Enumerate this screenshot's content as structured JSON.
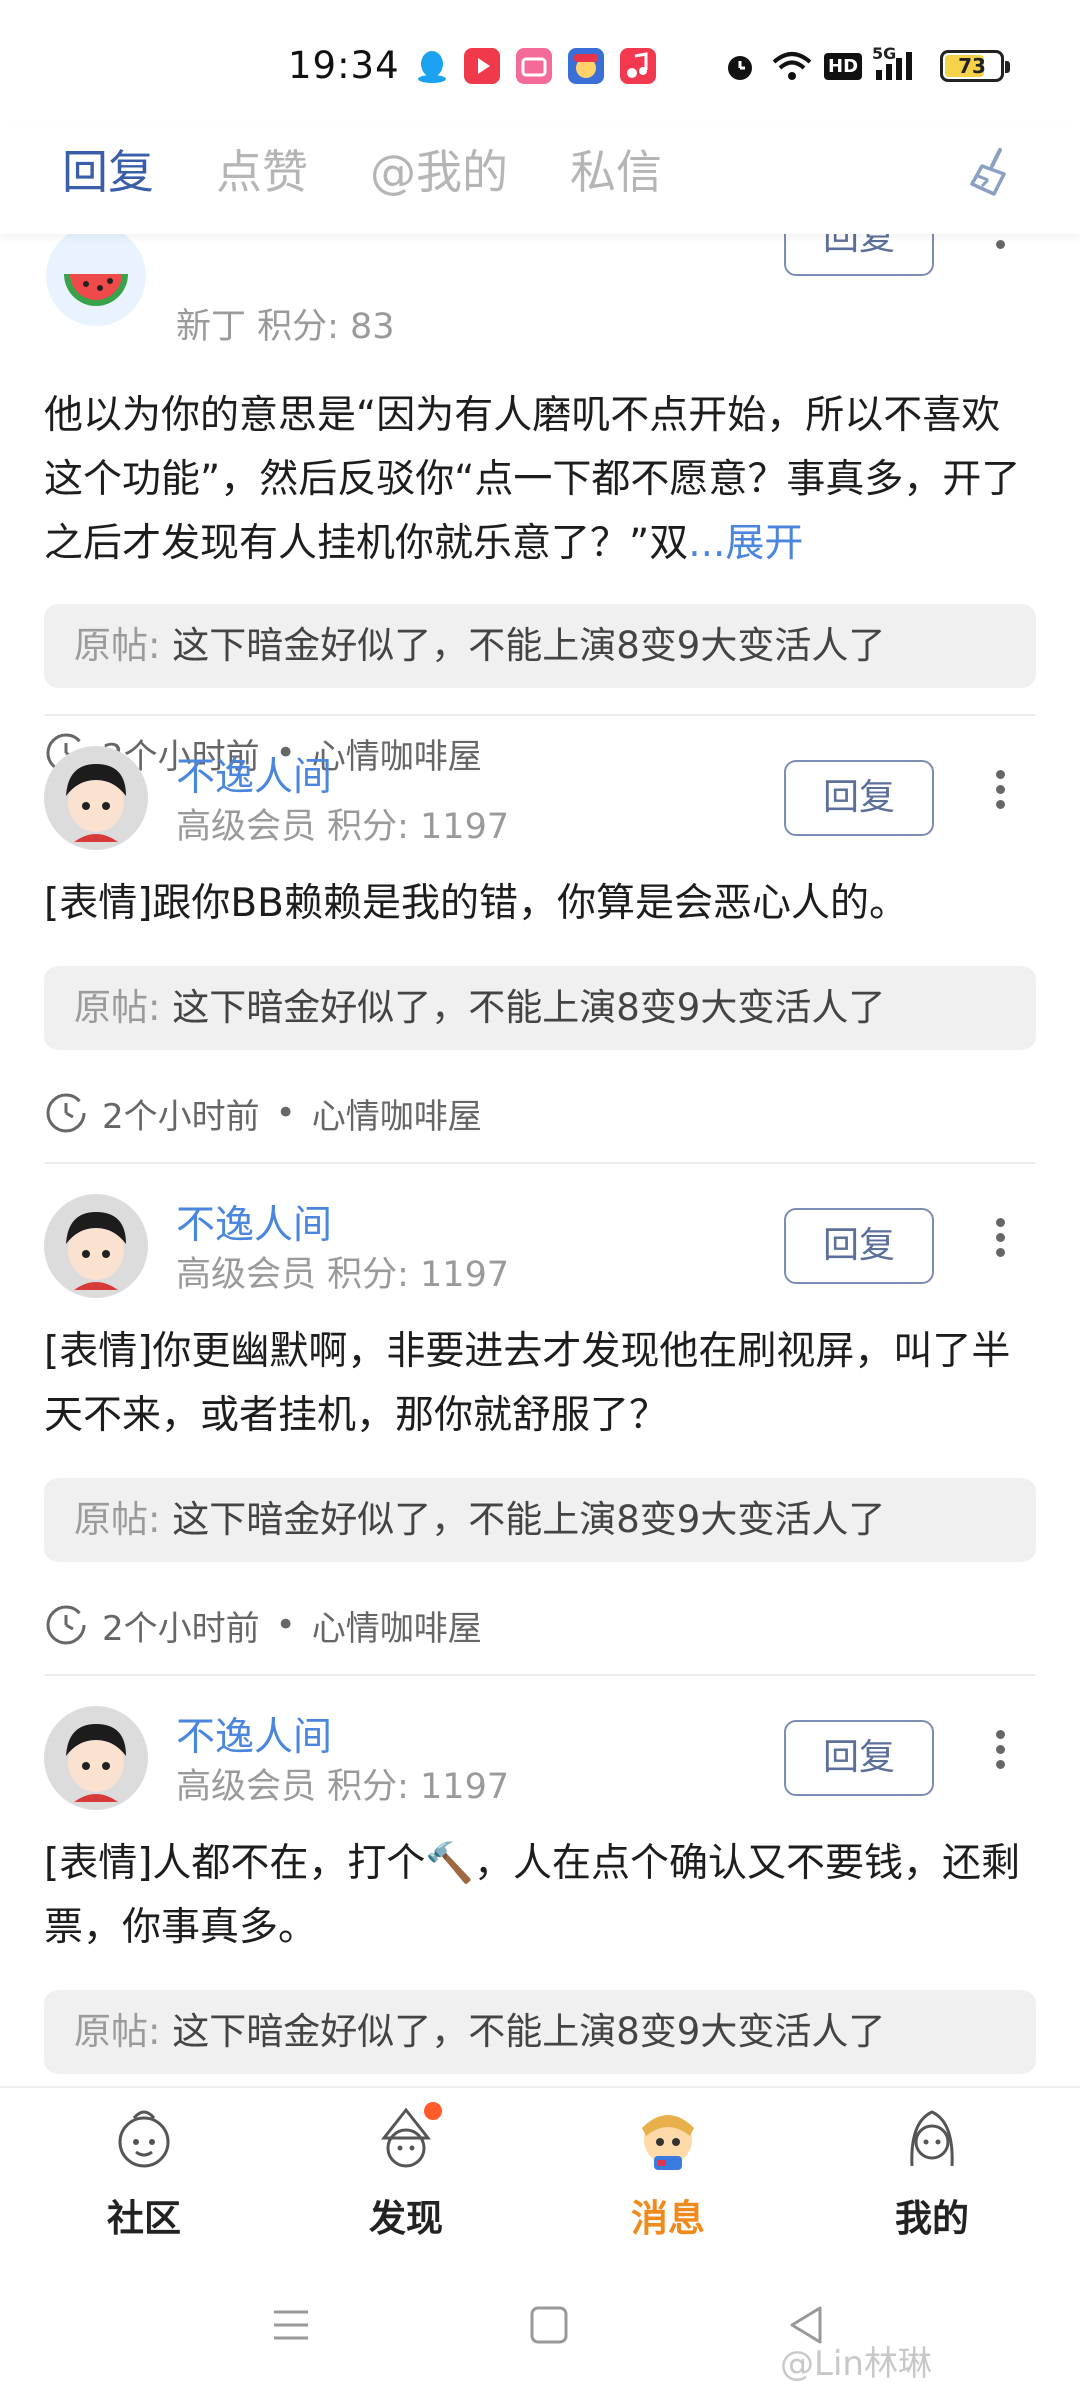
{
  "status_bar": {
    "time": "19:34",
    "battery": "73",
    "battery_level": 0.73,
    "network": "5G",
    "hd": "HD"
  },
  "tabs": [
    {
      "label": "回复",
      "active": true
    },
    {
      "label": "点赞",
      "active": false
    },
    {
      "label": "@我的",
      "active": false
    },
    {
      "label": "私信",
      "active": false
    }
  ],
  "items": [
    {
      "user_meta": "新丁 积分: 83",
      "reply_label": "回复",
      "text": "他以为你的意思是“因为有人磨叽不点开始，所以不喜欢这个功能”，然后反驳你“点一下都不愿意？事真多，开了之后才发现有人挂机你就乐意了？”双",
      "expand": "...展开",
      "origin_label": "原帖:",
      "origin_text": "这下暗金好似了，不能上演8变9大变活人了",
      "time": "2个小时前",
      "board": "心情咖啡屋"
    },
    {
      "user_name": "不逸人间",
      "user_meta": "高级会员 积分: 1197",
      "reply_label": "回复",
      "text": "[表情]跟你BB赖赖是我的错，你算是会恶心人的。",
      "origin_label": "原帖:",
      "origin_text": "这下暗金好似了，不能上演8变9大变活人了",
      "time": "2个小时前",
      "board": "心情咖啡屋"
    },
    {
      "user_name": "不逸人间",
      "user_meta": "高级会员 积分: 1197",
      "reply_label": "回复",
      "text": "[表情]你更幽默啊，非要进去才发现他在刷视屏，叫了半天不来，或者挂机，那你就舒服了？",
      "origin_label": "原帖:",
      "origin_text": "这下暗金好似了，不能上演8变9大变活人了",
      "time": "2个小时前",
      "board": "心情咖啡屋"
    },
    {
      "user_name": "不逸人间",
      "user_meta": "高级会员 积分: 1197",
      "reply_label": "回复",
      "text": "[表情]人都不在，打个🔨，人在点个确认又不要钱，还剩票，你事真多。",
      "origin_label": "原帖:",
      "origin_text": "这下暗金好似了，不能上演8变9大变活人了"
    }
  ],
  "bottom_nav": [
    {
      "label": "社区",
      "icon": "community-icon",
      "active": false
    },
    {
      "label": "发现",
      "icon": "discover-icon",
      "active": false,
      "badge": true
    },
    {
      "label": "消息",
      "icon": "message-icon",
      "active": true
    },
    {
      "label": "我的",
      "icon": "profile-icon",
      "active": false
    }
  ],
  "watermark": "@Lin林琳",
  "colors": {
    "accent": "#3b5ea8",
    "username": "#4a86dd",
    "active_nav": "#f08a1c"
  }
}
